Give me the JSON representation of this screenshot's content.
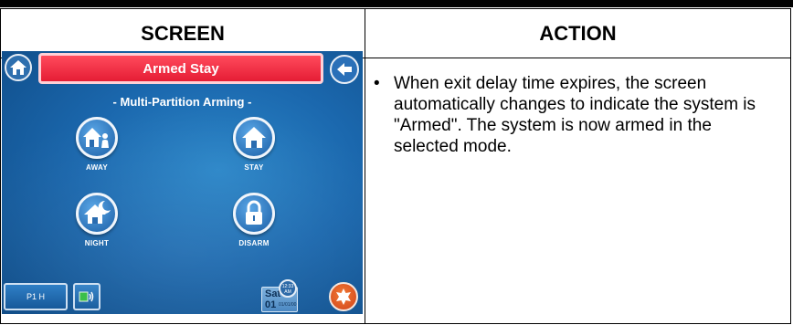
{
  "table": {
    "header_screen": "SCREEN",
    "header_action": "ACTION"
  },
  "screen": {
    "status_bar": "Armed Stay",
    "partition_title": "- Multi-Partition Arming -",
    "modes": [
      {
        "label": "AWAY",
        "icon": "home-away-icon"
      },
      {
        "label": "STAY",
        "icon": "home-stay-icon"
      },
      {
        "label": "NIGHT",
        "icon": "home-night-icon"
      },
      {
        "label": "DISARM",
        "icon": "lock-icon"
      }
    ],
    "partition_button": "P1 H",
    "date": {
      "day": "Sat",
      "number": "01",
      "full": "01/01/00"
    },
    "clock": {
      "time": "12:33",
      "ampm": "AM"
    },
    "colors": {
      "status_bar": "#e51d35",
      "background": "#1b68ae",
      "emergency": "#d2431a"
    }
  },
  "action": {
    "bullet": "•",
    "text": "When exit delay time expires, the screen automatically changes to indicate the system is \"Armed\".  The system is now armed in the selected mode."
  }
}
